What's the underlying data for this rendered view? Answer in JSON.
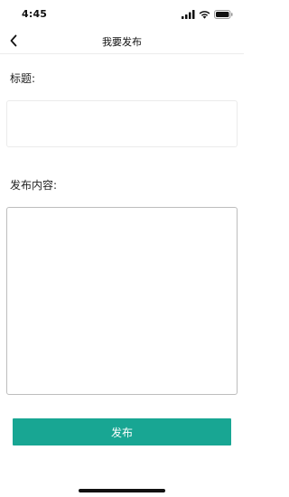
{
  "status_bar": {
    "time": "4:45",
    "icons": [
      "signal-icon",
      "wifi-icon",
      "battery-icon"
    ]
  },
  "nav": {
    "back_icon": "chevron-left-icon",
    "title": "我要发布"
  },
  "form": {
    "title_label": "标题:",
    "title_value": "",
    "content_label": "发布内容:",
    "content_value": ""
  },
  "actions": {
    "publish_label": "发布"
  },
  "colors": {
    "accent": "#18a693",
    "text": "#111111",
    "border": "#bdbdbd"
  }
}
